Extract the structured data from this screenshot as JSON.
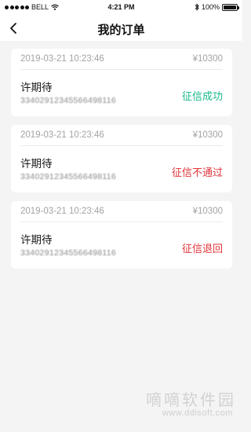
{
  "status_bar": {
    "carrier": "BELL",
    "time": "4:21 PM",
    "battery_text": "100%",
    "battery_level": 1.0,
    "icons": [
      "signal-dots-icon",
      "wifi-icon",
      "bluetooth-icon",
      "battery-icon"
    ]
  },
  "nav": {
    "title": "我的订单",
    "back_icon": "chevron-left-icon"
  },
  "orders": [
    {
      "time": "2019-03-21 10:23:46",
      "amount": "¥10300",
      "name": "许期待",
      "id_number": "33402912345566498116",
      "status": "征信成功",
      "status_color": "#19b98a"
    },
    {
      "time": "2019-03-21 10:23:46",
      "amount": "¥10300",
      "name": "许期待",
      "id_number": "33402912345566498116",
      "status": "征信不通过",
      "status_color": "#e0343a"
    },
    {
      "time": "2019-03-21 10:23:46",
      "amount": "¥10300",
      "name": "许期待",
      "id_number": "33402912345566498116",
      "status": "征信退回",
      "status_color": "#e0343a"
    }
  ],
  "watermark": {
    "text": "嘀嘀软件园",
    "url": "www.ddisoft.com"
  }
}
